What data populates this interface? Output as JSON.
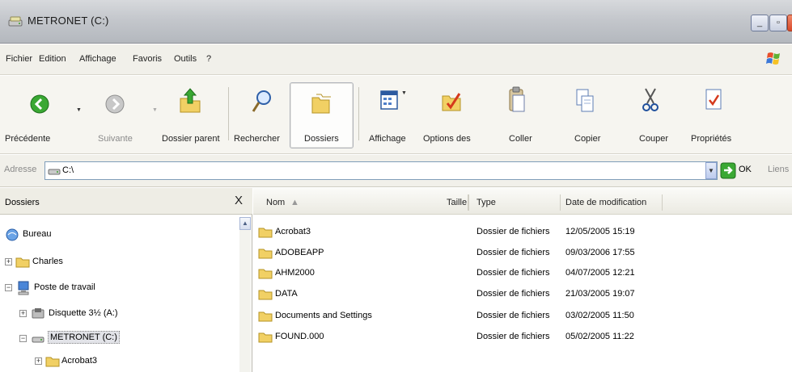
{
  "window": {
    "title": "METRONET (C:)"
  },
  "menu": [
    "Fichier",
    "Edition",
    "Affichage",
    "Favoris",
    "Outils",
    "?"
  ],
  "toolbar": {
    "back": "Précédente",
    "forward": "Suivante",
    "up": "Dossier parent",
    "search": "Rechercher",
    "folders": "Dossiers",
    "views": "Affichage",
    "options": "Options des",
    "paste": "Coller",
    "copy": "Copier",
    "cut": "Couper",
    "properties": "Propriétés"
  },
  "address": {
    "label": "Adresse",
    "value": "C:\\",
    "go": "OK",
    "links": "Liens"
  },
  "folders_pane": {
    "title": "Dossiers",
    "close": "X",
    "tree": [
      {
        "label": "Bureau",
        "icon": "desktop-icon"
      },
      {
        "label": "Charles",
        "icon": "folder-icon"
      },
      {
        "label": "Poste de travail",
        "icon": "computer-icon"
      },
      {
        "label": "Disquette 3½ (A:)",
        "icon": "floppy-icon"
      },
      {
        "label": "METRONET (C:)",
        "icon": "drive-icon",
        "selected": true
      },
      {
        "label": "Acrobat3",
        "icon": "folder-icon"
      }
    ]
  },
  "files": {
    "columns": {
      "name": "Nom",
      "size": "Taille",
      "type": "Type",
      "modified": "Date de modification"
    },
    "rows": [
      {
        "name": "Acrobat3",
        "type": "Dossier de fichiers",
        "modified": "12/05/2005 15:19"
      },
      {
        "name": "ADOBEAPP",
        "type": "Dossier de fichiers",
        "modified": "09/03/2006 17:55"
      },
      {
        "name": "AHM2000",
        "type": "Dossier de fichiers",
        "modified": "04/07/2005 12:21"
      },
      {
        "name": "DATA",
        "type": "Dossier de fichiers",
        "modified": "21/03/2005 19:07"
      },
      {
        "name": "Documents and Settings",
        "type": "Dossier de fichiers",
        "modified": "03/02/2005 11:50"
      },
      {
        "name": "FOUND.000",
        "type": "Dossier de fichiers",
        "modified": "05/02/2005 11:22"
      }
    ]
  }
}
